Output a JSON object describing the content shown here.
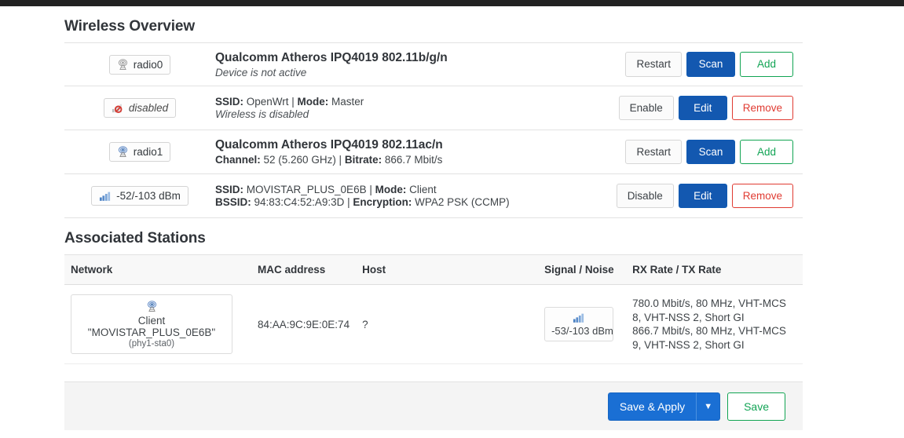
{
  "overview": {
    "title": "Wireless Overview",
    "rows": [
      {
        "badge": {
          "icon": "radio-tower-icon",
          "label": "radio0",
          "state": "inactive"
        },
        "title": "Qualcomm Atheros IPQ4019 802.11b/g/n",
        "sub1_label": "",
        "sub1_value": "Device is not active",
        "sub2_label": "",
        "sub2_value": "",
        "buttons": [
          {
            "name": "restart-button",
            "label": "Restart",
            "style": "neutral"
          },
          {
            "name": "scan-button",
            "label": "Scan",
            "style": "primary"
          },
          {
            "name": "add-button",
            "label": "Add",
            "style": "success"
          }
        ]
      },
      {
        "badge": {
          "icon": "signal-disabled-icon",
          "label": "disabled",
          "state": "disabled"
        },
        "title": "",
        "line1": "SSID: OpenWrt | Mode: Master",
        "line1_parts": [
          {
            "b": "SSID:",
            "t": " OpenWrt | "
          },
          {
            "b": "Mode:",
            "t": " Master"
          }
        ],
        "line2": "Wireless is disabled",
        "buttons": [
          {
            "name": "enable-button",
            "label": "Enable",
            "style": "neutral"
          },
          {
            "name": "edit-button",
            "label": "Edit",
            "style": "primary"
          },
          {
            "name": "remove-button",
            "label": "Remove",
            "style": "danger"
          }
        ]
      },
      {
        "badge": {
          "icon": "radio-tower-icon",
          "label": "radio1",
          "state": "active"
        },
        "title": "Qualcomm Atheros IPQ4019 802.11ac/n",
        "line1_parts": [
          {
            "b": "Channel:",
            "t": " 52 (5.260 GHz) | "
          },
          {
            "b": "Bitrate:",
            "t": " 866.7 Mbit/s"
          }
        ],
        "buttons": [
          {
            "name": "restart-button",
            "label": "Restart",
            "style": "neutral"
          },
          {
            "name": "scan-button",
            "label": "Scan",
            "style": "primary"
          },
          {
            "name": "add-button",
            "label": "Add",
            "style": "success"
          }
        ]
      },
      {
        "badge": {
          "icon": "signal-bars-icon",
          "label": "-52/-103 dBm",
          "state": "signal"
        },
        "line1_parts": [
          {
            "b": "SSID:",
            "t": " MOVISTAR_PLUS_0E6B | "
          },
          {
            "b": "Mode:",
            "t": " Client"
          }
        ],
        "line2_parts": [
          {
            "b": "BSSID:",
            "t": " 94:83:C4:52:A9:3D | "
          },
          {
            "b": "Encryption:",
            "t": " WPA2 PSK (CCMP)"
          }
        ],
        "buttons": [
          {
            "name": "disable-button",
            "label": "Disable",
            "style": "neutral"
          },
          {
            "name": "edit-button",
            "label": "Edit",
            "style": "primary"
          },
          {
            "name": "remove-button",
            "label": "Remove",
            "style": "danger"
          }
        ]
      }
    ]
  },
  "stations": {
    "title": "Associated Stations",
    "columns": [
      "Network",
      "MAC address",
      "Host",
      "Signal / Noise",
      "RX Rate / TX Rate"
    ],
    "rows": [
      {
        "network_icon": "radio-tower-icon",
        "network_name": "Client \"MOVISTAR_PLUS_0E6B\"",
        "network_iface": "(phy1-sta0)",
        "mac": "84:AA:9C:9E:0E:74",
        "host": "?",
        "signal_icon": "signal-bars-icon",
        "signal": "-53/-103 dBm",
        "rx_rate": "780.0 Mbit/s, 80 MHz, VHT-MCS 8, VHT-NSS 2, Short GI",
        "tx_rate": "866.7 Mbit/s, 80 MHz, VHT-MCS 9, VHT-NSS 2, Short GI"
      }
    ]
  },
  "footer": {
    "save_apply_label": "Save & Apply",
    "dropdown_caret": "▼",
    "save_label": "Save"
  },
  "colors": {
    "primary_blue": "#1358b0",
    "apply_blue": "#1a6fd4",
    "success_green": "#12a455",
    "danger_red": "#e03b32",
    "topbar": "#222222"
  }
}
